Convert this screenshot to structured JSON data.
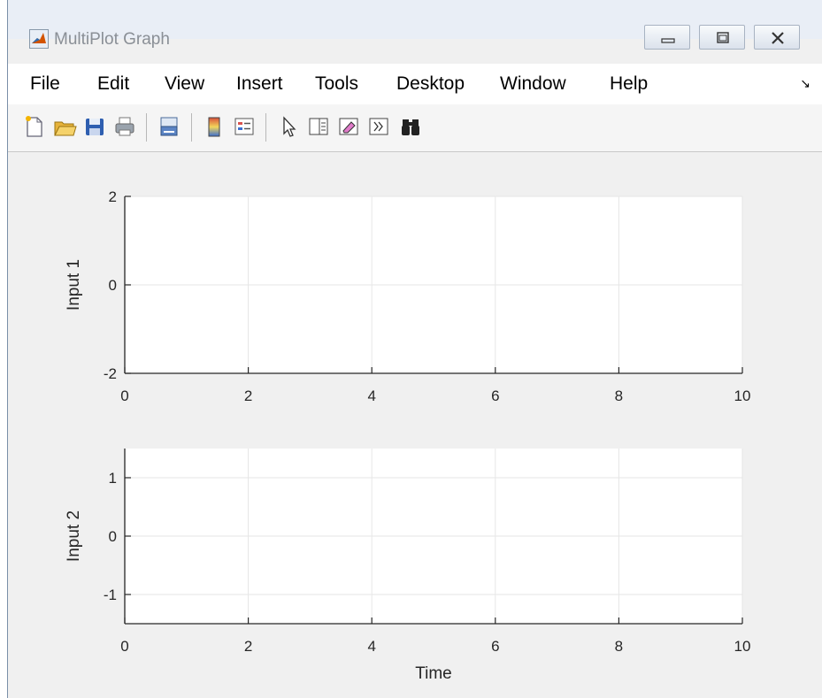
{
  "window": {
    "title": "MultiPlot Graph",
    "controls": [
      "minimize",
      "maximize",
      "close"
    ]
  },
  "menu": {
    "items": [
      "File",
      "Edit",
      "View",
      "Insert",
      "Tools",
      "Desktop",
      "Window",
      "Help"
    ],
    "overflow_arrow": "↘"
  },
  "toolbar": {
    "buttons": [
      {
        "name": "new-figure-icon"
      },
      {
        "name": "open-file-icon"
      },
      {
        "name": "save-icon"
      },
      {
        "name": "print-icon"
      },
      {
        "name": "link-plot-icon"
      },
      {
        "name": "colorbar-icon"
      },
      {
        "name": "legend-icon"
      },
      {
        "name": "edit-plot-pointer-icon"
      },
      {
        "name": "property-inspector-icon"
      },
      {
        "name": "eraser-icon"
      },
      {
        "name": "expand-toolbar-icon"
      },
      {
        "name": "find-binoculars-icon"
      }
    ]
  },
  "colors": {
    "axes_background": "#ffffff",
    "figure_background": "#f0f0f0",
    "grid": "#e6e6e6",
    "axis_line": "#262626",
    "tick_label": "#262626"
  },
  "chart_data": [
    {
      "type": "line",
      "title": "",
      "xlabel": "",
      "ylabel": "Input 1",
      "xlim": [
        0,
        10
      ],
      "ylim": [
        -2,
        2
      ],
      "xticks": [
        0,
        2,
        4,
        6,
        8,
        10
      ],
      "yticks": [
        -2,
        0,
        2
      ],
      "xtick_labels": [
        "0",
        "2",
        "4",
        "6",
        "8",
        "10"
      ],
      "ytick_labels": [
        "-2",
        "0",
        "2"
      ],
      "grid": true,
      "series": []
    },
    {
      "type": "line",
      "title": "",
      "xlabel": "Time",
      "ylabel": "Input 2",
      "xlim": [
        0,
        10
      ],
      "ylim": [
        -1.5,
        1.5
      ],
      "xticks": [
        0,
        2,
        4,
        6,
        8,
        10
      ],
      "yticks": [
        -1,
        0,
        1
      ],
      "xtick_labels": [
        "0",
        "2",
        "4",
        "6",
        "8",
        "10"
      ],
      "ytick_labels": [
        "-1",
        "0",
        "1"
      ],
      "grid": true,
      "series": []
    }
  ]
}
